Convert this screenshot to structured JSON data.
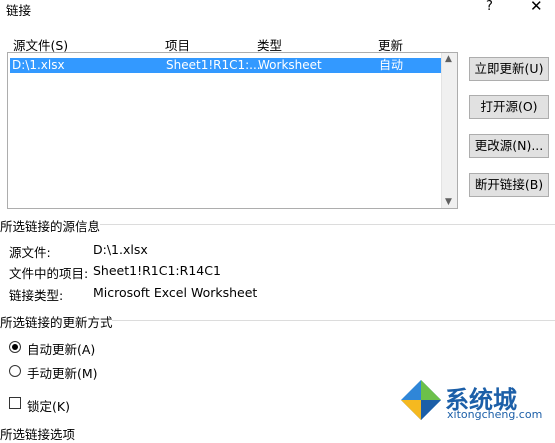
{
  "window": {
    "title": "链接",
    "help": "?",
    "close": "✕"
  },
  "columns": {
    "source": "源文件(S)",
    "item": "项目",
    "type": "类型",
    "update": "更新"
  },
  "links": [
    {
      "source": "D:\\1.xlsx",
      "item": "Sheet1!R1C1:...",
      "type": "Worksheet",
      "update": "自动"
    }
  ],
  "buttons": {
    "update_now": "立即更新(U)",
    "open_source": "打开源(O)",
    "change_source": "更改源(N)...",
    "break_link": "断开链接(B)"
  },
  "source_info": {
    "heading": "所选链接的源信息",
    "source_label": "源文件:",
    "source_value": "D:\\1.xlsx",
    "item_label": "文件中的项目:",
    "item_value": "Sheet1!R1C1:R14C1",
    "type_label": "链接类型:",
    "type_value": "Microsoft Excel Worksheet"
  },
  "update_method": {
    "heading": "所选链接的更新方式",
    "auto": "自动更新(A)",
    "manual": "手动更新(M)",
    "lock": "锁定(K)",
    "selected": "auto"
  },
  "options": {
    "heading": "所选链接选项"
  },
  "watermark": {
    "brand": "系统城",
    "url": "xitongcheng.com"
  }
}
